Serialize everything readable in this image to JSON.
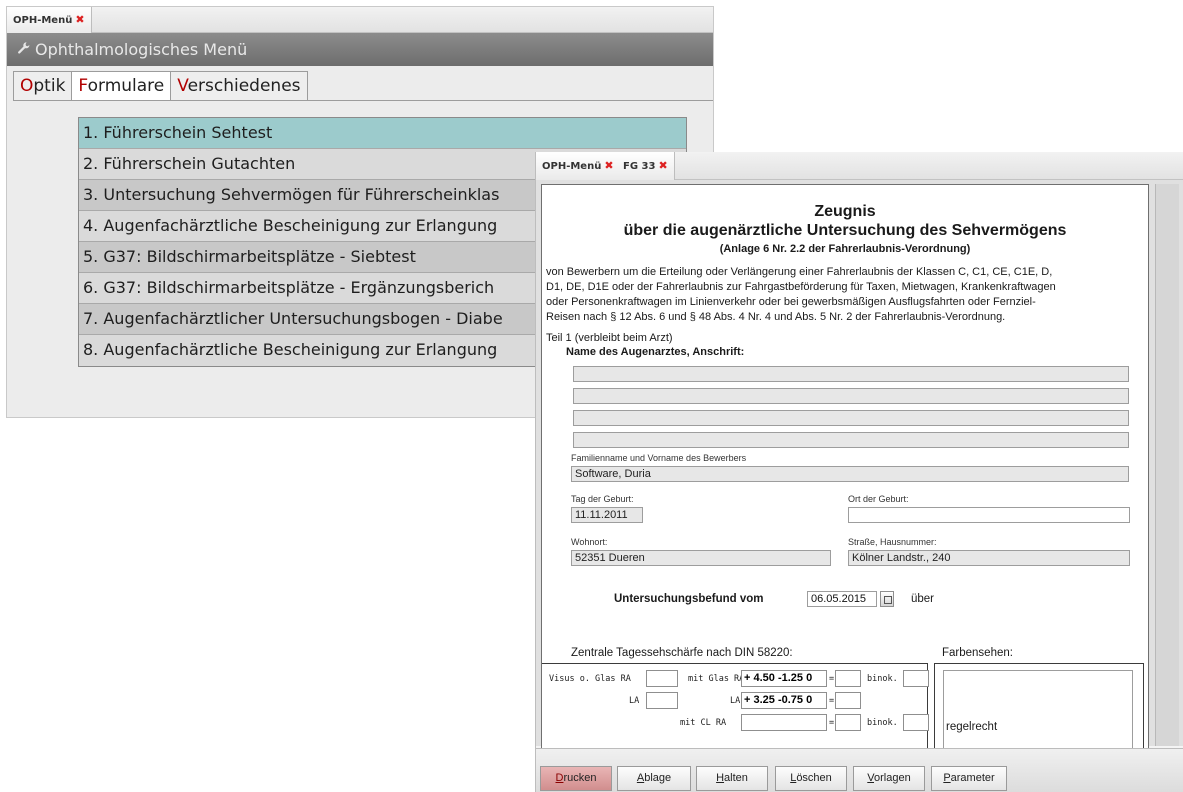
{
  "window1": {
    "tab_label": "OPH-Menü",
    "tab_close": "✖",
    "title": "Ophthalmologisches Menü",
    "menu_tabs": [
      {
        "accent": "O",
        "rest": "ptik"
      },
      {
        "accent": "F",
        "rest": "ormulare"
      },
      {
        "accent": "V",
        "rest": "erschiedenes"
      }
    ],
    "active_tab": "Formulare",
    "items": [
      "1. Führerschein Sehtest",
      "2. Führerschein Gutachten",
      "3. Untersuchung Sehvermögen für Führerscheinklas",
      "4. Augenfachärztliche Bescheinigung zur Erlangung",
      "5. G37: Bildschirmarbeitsplätze - Siebtest",
      "6. G37: Bildschirmarbeitsplätze - Ergänzungsberich",
      "7. Augenfachärztlicher Untersuchungsbogen - Diabe",
      "8. Augenfachärztliche Bescheinigung zur Erlangung"
    ]
  },
  "window2": {
    "tabs": [
      {
        "label": "OPH-Menü",
        "close": "✖"
      },
      {
        "label": "FG 33",
        "close": "✖"
      }
    ],
    "form": {
      "title": "Zeugnis",
      "subtitle": "über die augenärztliche Untersuchung des Sehvermögens",
      "subnote": "(Anlage 6 Nr. 2.2 der Fahrerlaubnis-Verordnung)",
      "intro": [
        "von Bewerbern um die Erteilung oder Verlängerung einer Fahrerlaubnis der Klassen C, C1, CE, C1E, D,",
        "D1, DE, D1E oder der Fahrerlaubnis zur Fahrgastbeförderung für Taxen, Mietwagen, Krankenkraftwagen",
        "oder Personenkraftwagen im Linienverkehr oder bei gewerbsmäßigen Ausflugsfahrten oder Fernziel-",
        "Reisen nach § 12 Abs. 6 und § 48 Abs. 4 Nr. 4 und Abs. 5 Nr. 2 der Fahrerlaubnis-Verordnung."
      ],
      "teil1": "Teil 1",
      "teil1_note": "(verbleibt beim Arzt)",
      "arzt_label": "Name des Augenarztes, Anschrift:",
      "name_label": "Familienname und Vorname des Bewerbers",
      "name_value": "Software, Duria",
      "birthday_label": "Tag der Geburt:",
      "birthday_value": "11.11.2011",
      "birthplace_label": "Ort der Geburt:",
      "birthplace_value": "",
      "city_label": "Wohnort:",
      "city_value": "52351 Dueren",
      "street_label": "Straße, Hausnummer:",
      "street_value": "Kölner Landstr., 240",
      "befund_label": "Untersuchungsbefund vom",
      "befund_date": "06.05.2015",
      "befund_suffix": "über",
      "visus_title": "Zentrale Tagessehschärfe nach DIN 58220:",
      "farb_title": "Farbensehen:",
      "visus_o_glas_ra": "Visus o. Glas RA",
      "mit_glas_ra": "mit Glas RA",
      "ra_glass_value": "+ 4.50 -1.25  0",
      "la_label": "LA",
      "la_glass_value": "+ 3.25 -0.75  0",
      "mit_cl_ra": "mit CL RA",
      "equals": "=",
      "binok": "binok.",
      "farb_value": "regelrecht"
    },
    "buttons": [
      {
        "accent": "D",
        "rest": "rucken"
      },
      {
        "accent": "A",
        "rest": "blage"
      },
      {
        "accent": "H",
        "rest": "alten"
      },
      {
        "accent": "L",
        "rest": "öschen"
      },
      {
        "accent": "V",
        "rest": "orlagen"
      },
      {
        "accent": "P",
        "rest": "arameter"
      }
    ]
  },
  "colors": {
    "title_bar": "#7a7a7a",
    "selected_item": "#9ccbcc",
    "accent_letter": "#b10000",
    "close_x": "#dd2222",
    "print_button": "#dca0a0"
  }
}
